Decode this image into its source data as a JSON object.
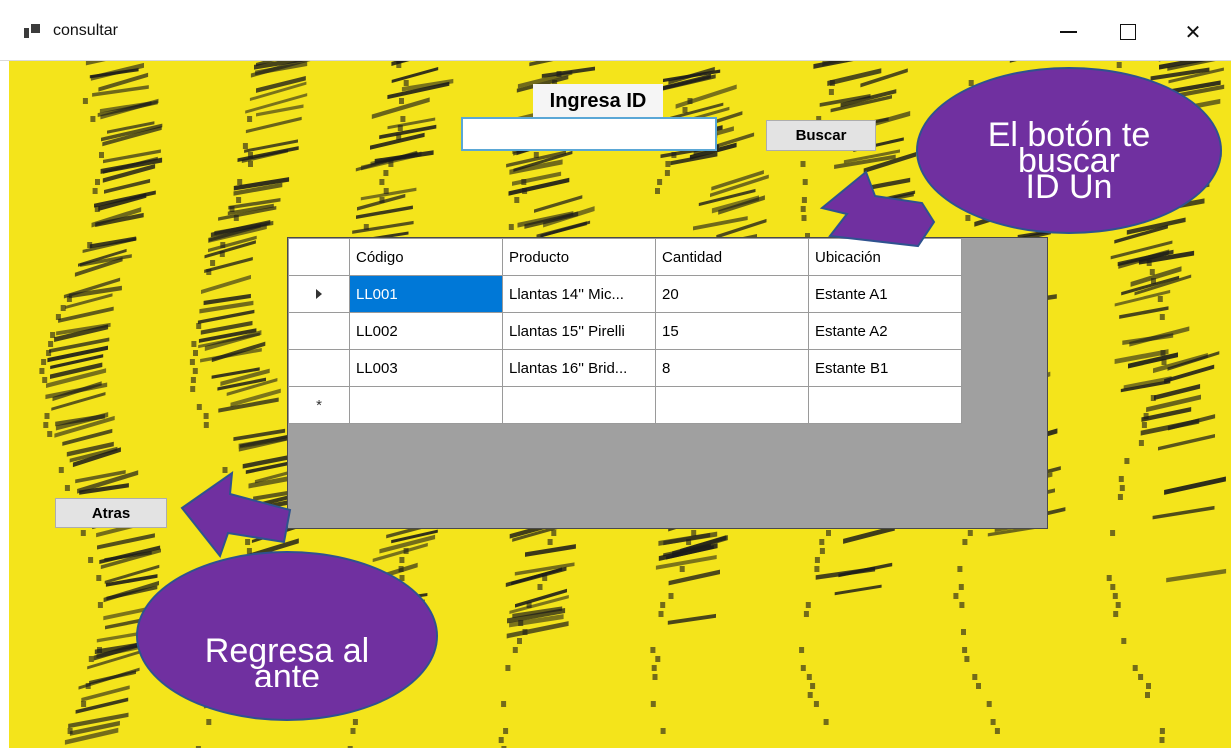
{
  "window": {
    "title": "consultar",
    "minimize_label": "—",
    "maximize_label": "☐",
    "close_label": "✕"
  },
  "form": {
    "heading": "Ingresa ID",
    "id_input_value": "",
    "search_button": "Buscar",
    "back_button": "Atras"
  },
  "grid": {
    "columns": [
      "Código",
      "Producto",
      "Cantidad",
      "Ubicación"
    ],
    "rows": [
      {
        "codigo": "LL001",
        "producto": "Llantas 14'' Mic...",
        "cantidad": "20",
        "ubicacion": "Estante A1",
        "current": true
      },
      {
        "codigo": "LL002",
        "producto": "Llantas 15'' Pirelli",
        "cantidad": "15",
        "ubicacion": "Estante A2",
        "current": false
      },
      {
        "codigo": "LL003",
        "producto": "Llantas 16'' Brid...",
        "cantidad": "8",
        "ubicacion": "Estante B1",
        "current": false
      }
    ],
    "new_row_marker": "*",
    "selected_cell_color": "#0078d7"
  },
  "callouts": {
    "top": [
      "El botón te",
      "buscar",
      "ID Un"
    ],
    "bottom": [
      "Regresa al",
      "ante"
    ],
    "fill_color": "#7030a0"
  },
  "colors": {
    "background": "#f4e41b",
    "tracks": "#1a1a1a"
  },
  "icons": {
    "app": "app-icon",
    "current_row": "row-pointer-icon"
  }
}
